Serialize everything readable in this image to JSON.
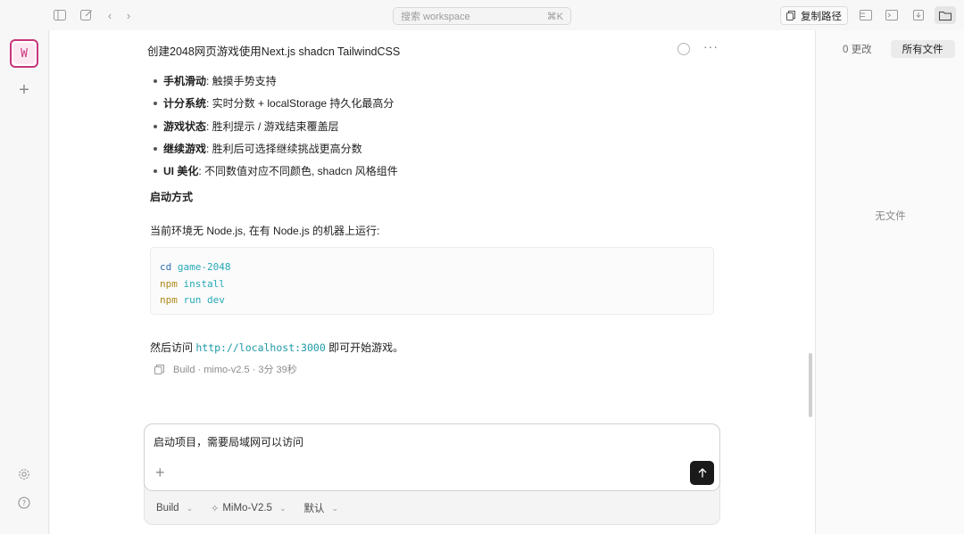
{
  "topbar": {
    "search_placeholder": "搜索 workspace",
    "search_shortcut": "⌘K",
    "copy_path_label": "复制路径"
  },
  "workspace": {
    "avatar_letter": "W"
  },
  "conversation": {
    "title": "创建2048网页游戏使用Next.js shadcn TailwindCSS",
    "features": [
      {
        "bold": "手机滑动",
        "text": ": 触摸手势支持"
      },
      {
        "bold": "计分系统",
        "text": ": 实时分数 + localStorage 持久化最高分"
      },
      {
        "bold": "游戏状态",
        "text": ": 胜利提示 / 游戏结束覆盖层"
      },
      {
        "bold": "继续游戏",
        "text": ": 胜利后可选择继续挑战更高分数"
      },
      {
        "bold": "UI 美化",
        "text": ": 不同数值对应不同颜色, shadcn 风格组件"
      }
    ],
    "section_heading": "启动方式",
    "run_instruction": "当前环境无 Node.js, 在有 Node.js 的机器上运行:",
    "code_lines": [
      {
        "cmd": "cd",
        "args": "game-2048"
      },
      {
        "cmd": "npm",
        "args": "install"
      },
      {
        "cmd": "npm",
        "args": "run dev"
      }
    ],
    "visit_prefix": "然后访问 ",
    "visit_url": "http://localhost:3000",
    "visit_suffix": " 即可开始游戏。",
    "meta": "Build · mimo-v2.5 · 3分 39秒"
  },
  "composer": {
    "input_text": "启动项目，需要局域网可以访问",
    "agent": "Build",
    "model": "MiMo-V2.5",
    "variant": "默认"
  },
  "right_panel": {
    "tab_changes": "0 更改",
    "tab_all_files": "所有文件",
    "empty_text": "无文件"
  }
}
